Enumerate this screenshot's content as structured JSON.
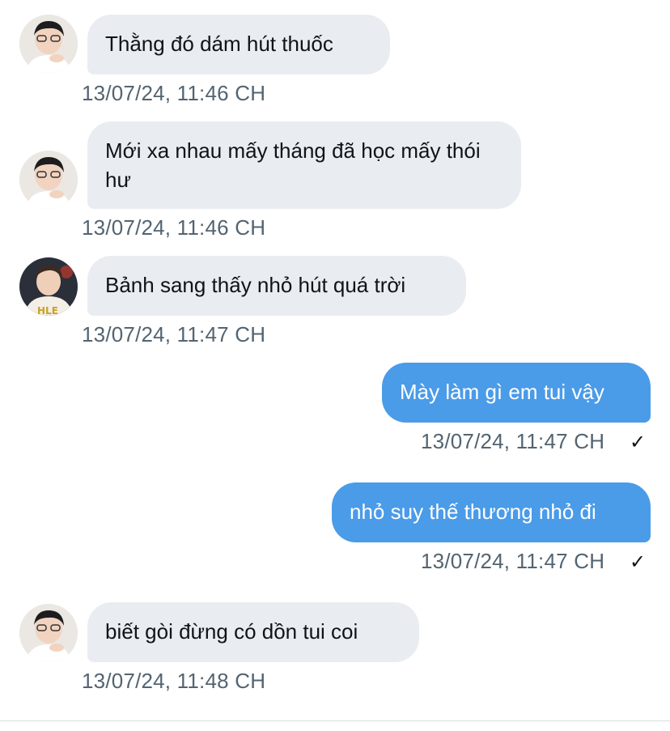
{
  "conversation": {
    "messages": [
      {
        "direction": "incoming",
        "avatar": "avatar-user-a",
        "text": "Thằng đó dám hút thuốc",
        "time": "13/07/24, 11:46 CH"
      },
      {
        "direction": "incoming",
        "avatar": "avatar-user-a",
        "text": "Mới xa nhau mấy tháng đã học mấy thói hư",
        "time": "13/07/24, 11:46 CH"
      },
      {
        "direction": "incoming",
        "avatar": "avatar-user-b",
        "text": "Bảnh sang thấy nhỏ hút quá trời",
        "time": "13/07/24, 11:47 CH"
      },
      {
        "direction": "outgoing",
        "text": "Mày làm gì em tui vậy",
        "time": "13/07/24, 11:47 CH",
        "status_icon": "check-icon"
      },
      {
        "direction": "outgoing",
        "text": "nhỏ suy thế thương nhỏ đi",
        "time": "13/07/24, 11:47 CH",
        "status_icon": "check-icon"
      },
      {
        "direction": "incoming",
        "avatar": "avatar-user-a",
        "text": "biết gòi đừng có dồn tui coi",
        "time": "13/07/24, 11:48 CH"
      }
    ],
    "check_glyph": "✓"
  },
  "colors": {
    "incoming_bubble": "#e9ecf0",
    "outgoing_bubble": "#4a9be8",
    "timestamp": "#536471",
    "text": "#0f1419"
  }
}
